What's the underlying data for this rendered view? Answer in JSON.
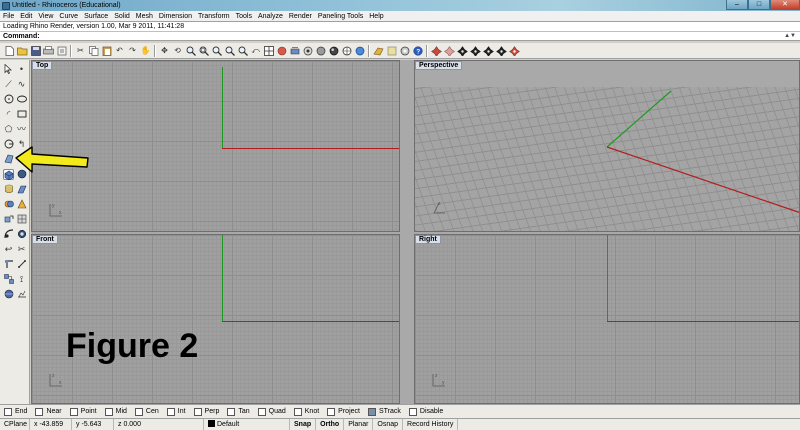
{
  "window": {
    "title": "Untitled - Rhinoceros (Educational)"
  },
  "menu": [
    "File",
    "Edit",
    "View",
    "Curve",
    "Surface",
    "Solid",
    "Mesh",
    "Dimension",
    "Transform",
    "Tools",
    "Analyze",
    "Render",
    "Paneling Tools",
    "Help"
  ],
  "command_history": "Loading Rhino Render, version 1.00, Mar 9 2011, 11:41:28",
  "command_prompt": "Command:",
  "viewports": {
    "top": "Top",
    "perspective": "Perspective",
    "front": "Front",
    "right": "Right"
  },
  "figure_label": "Figure 2",
  "osnaps": [
    {
      "label": "End",
      "checked": false
    },
    {
      "label": "Near",
      "checked": false
    },
    {
      "label": "Point",
      "checked": false
    },
    {
      "label": "Mid",
      "checked": false
    },
    {
      "label": "Cen",
      "checked": false
    },
    {
      "label": "Int",
      "checked": false
    },
    {
      "label": "Perp",
      "checked": false
    },
    {
      "label": "Tan",
      "checked": false
    },
    {
      "label": "Quad",
      "checked": false
    },
    {
      "label": "Knot",
      "checked": false
    },
    {
      "label": "Project",
      "checked": false
    },
    {
      "label": "STrack",
      "checked": true
    },
    {
      "label": "Disable",
      "checked": false
    }
  ],
  "status": {
    "cplane": "CPlane",
    "x": "x -43.859",
    "y": "y -5.643",
    "z": "z 0.000",
    "layer": "Default",
    "snap": "Snap",
    "ortho": "Ortho",
    "planar": "Planar",
    "osnap": "Osnap",
    "record_history": "Record History"
  },
  "colors": {
    "x_axis": "#b21d1d",
    "y_axis": "#1d9a1d",
    "annotation_arrow": "#f2ea1a"
  }
}
